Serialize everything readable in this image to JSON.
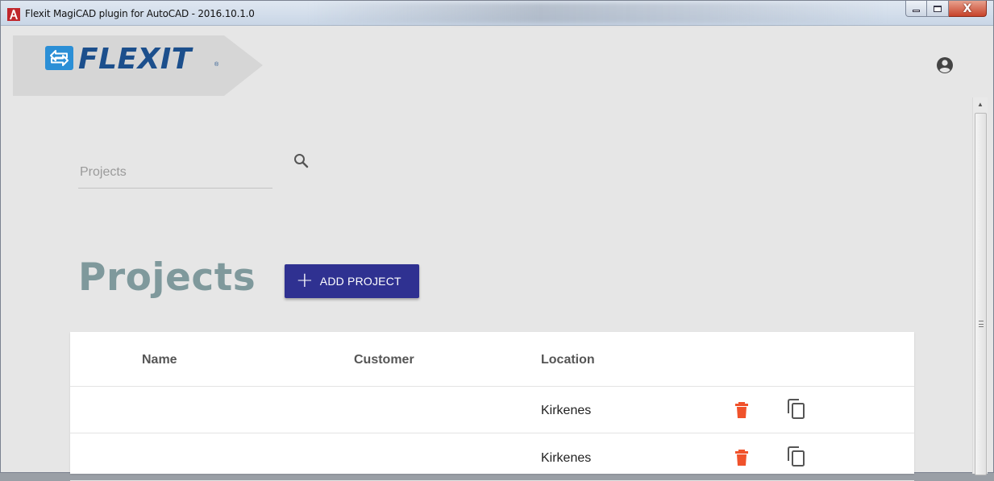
{
  "window": {
    "title": "Flexit MagiCAD plugin for AutoCAD - 2016.10.1.0",
    "buttons": {
      "minimize": "minimize",
      "maximize": "maximize",
      "close": "X"
    }
  },
  "brand": {
    "logo_text": "FLEXIT",
    "registered": "®",
    "accent": "#1c4f8c"
  },
  "header": {
    "user_icon": "user-circle-icon"
  },
  "search": {
    "placeholder": "Projects",
    "value": "",
    "icon": "search-icon"
  },
  "page": {
    "title": "Projects",
    "add_button": {
      "icon": "+",
      "label": "ADD PROJECT",
      "color": "#2f3191"
    }
  },
  "table": {
    "columns": [
      "Name",
      "Customer",
      "Location"
    ],
    "rows": [
      {
        "name": "",
        "customer": "",
        "location": "Kirkenes",
        "actions": [
          "trash-icon",
          "copy-icon"
        ]
      },
      {
        "name": "",
        "customer": "",
        "location": "Kirkenes",
        "actions": [
          "trash-icon",
          "copy-icon"
        ]
      }
    ],
    "delete_color": "#f0522b"
  }
}
